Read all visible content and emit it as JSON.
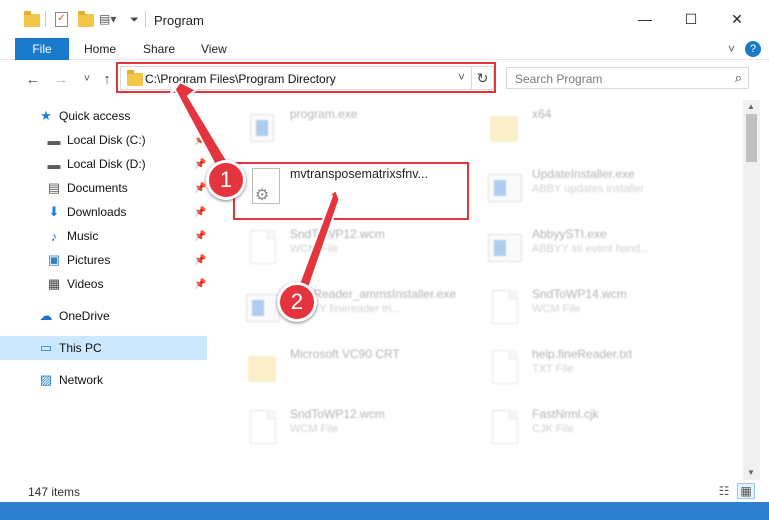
{
  "window": {
    "title": "Program",
    "minimize_glyph": "—",
    "maximize_glyph": "☐",
    "close_glyph": "✕"
  },
  "ribbon": {
    "tabs": [
      "File",
      "Home",
      "Share",
      "View"
    ],
    "help_glyph": "?",
    "expand_glyph": "˅"
  },
  "nav": {
    "back": "←",
    "forward": "→",
    "recent": "˅",
    "up": "↑"
  },
  "address": {
    "path": "C:\\Program Files\\Program Directory",
    "refresh_glyph": "↻",
    "dropdown_glyph": "˅"
  },
  "search": {
    "placeholder": "Search Program",
    "icon_glyph": "⌕"
  },
  "sidebar": {
    "items": [
      {
        "label": "Quick access",
        "icon": "star-icon",
        "glyph": "★",
        "color": "#1e7fd8"
      },
      {
        "label": "Local Disk (C:)",
        "icon": "drive-icon",
        "glyph": "▬",
        "color": "#5a5a5a",
        "pinned": true
      },
      {
        "label": "Local Disk (D:)",
        "icon": "drive-icon",
        "glyph": "▬",
        "color": "#5a5a5a",
        "pinned": true
      },
      {
        "label": "Documents",
        "icon": "documents-icon",
        "glyph": "▤",
        "color": "#5a5a5a",
        "pinned": true
      },
      {
        "label": "Downloads",
        "icon": "download-icon",
        "glyph": "⬇",
        "color": "#1e7fd8",
        "pinned": true
      },
      {
        "label": "Music",
        "icon": "music-icon",
        "glyph": "♪",
        "color": "#1e7fd8",
        "pinned": true
      },
      {
        "label": "Pictures",
        "icon": "pictures-icon",
        "glyph": "▣",
        "color": "#3a7cc0",
        "pinned": true
      },
      {
        "label": "Videos",
        "icon": "videos-icon",
        "glyph": "▦",
        "color": "#444444",
        "pinned": true
      },
      {
        "label": "OneDrive",
        "icon": "cloud-icon",
        "glyph": "☁",
        "color": "#1e6fc8"
      },
      {
        "label": "This PC",
        "icon": "computer-icon",
        "glyph": "▭",
        "color": "#1e7fd8",
        "selected": true
      },
      {
        "label": "Network",
        "icon": "network-icon",
        "glyph": "▨",
        "color": "#1e7fd8"
      }
    ],
    "pin_glyph": "📌"
  },
  "files": [
    {
      "name": "program.exe",
      "desc": "",
      "icon": "installer-icon",
      "dim": true
    },
    {
      "name": "x64",
      "desc": "",
      "icon": "folder-icon",
      "dim": true
    },
    {
      "name": "mvtransposematrixsfnv...",
      "desc": "",
      "icon": "dll-gear-icon",
      "dim": false
    },
    {
      "name": "UpdateInstaller.exe",
      "desc": "ABBY updates installer",
      "icon": "app-icon",
      "dim": true
    },
    {
      "name": "SndToWP12.wcm",
      "desc": "WCM File",
      "icon": "document-icon",
      "dim": true
    },
    {
      "name": "AbbyySTI.exe",
      "desc": "ABBYY sti event hand...",
      "icon": "app-icon",
      "dim": true
    },
    {
      "name": "FineReader_ammsInstaller.exe",
      "desc": "ABBYY finereader tri...",
      "icon": "app-icon",
      "dim": true
    },
    {
      "name": "SndToWP14.wcm",
      "desc": "WCM File",
      "icon": "document-icon",
      "dim": true
    },
    {
      "name": "Microsoft VC90 CRT",
      "desc": "",
      "icon": "folder-icon",
      "dim": true
    },
    {
      "name": "help.fineReader.txt",
      "desc": "TXT File",
      "icon": "document-icon",
      "dim": true
    },
    {
      "name": "SndToWP12.wcm",
      "desc": "WCM File",
      "icon": "document-icon",
      "dim": true
    },
    {
      "name": "FastNrml.cjk",
      "desc": "CJK File",
      "icon": "document-icon",
      "dim": true
    }
  ],
  "status": {
    "count": "147 items",
    "details_glyph": "☷",
    "tiles_glyph": "▦"
  },
  "annotations": {
    "badge1": "1",
    "badge2": "2"
  }
}
